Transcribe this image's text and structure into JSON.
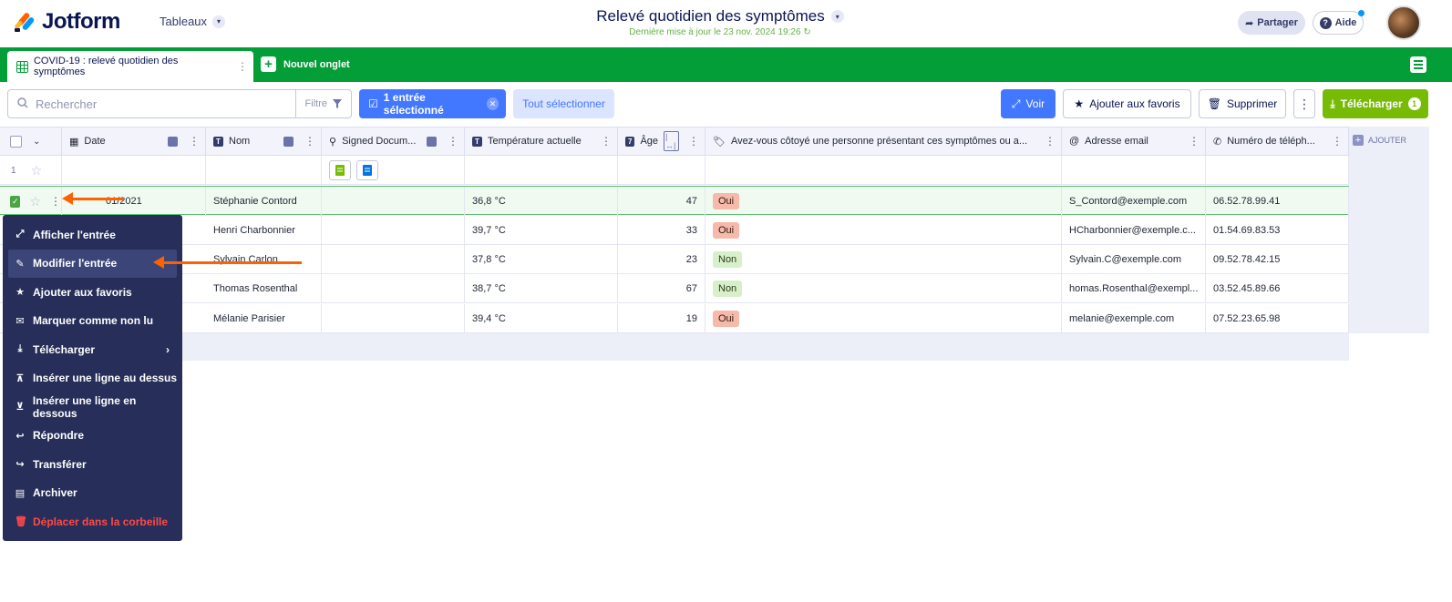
{
  "header": {
    "brand": "Jotform",
    "tables_menu": "Tableaux",
    "title": "Relevé quotidien des symptômes",
    "subtitle": "Dernière mise à jour le 23 nov. 2024 19:26",
    "share_label": "Partager",
    "help_label": "Aide"
  },
  "tabs": {
    "active_tab": "COVID-19 : relevé quotidien des symptômes",
    "new_tab": "Nouvel onglet"
  },
  "toolbar": {
    "search_placeholder": "Rechercher",
    "filter_label": "Filtre",
    "selected_label": "1 entrée sélectionné",
    "select_all_label": "Tout sélectionner",
    "view_label": "Voir",
    "favorite_label": "Ajouter aux favoris",
    "delete_label": "Supprimer",
    "download_label": "Télécharger",
    "download_count": "1"
  },
  "columns": {
    "date": "Date",
    "name": "Nom",
    "signed": "Signed Docum...",
    "temperature": "Température actuelle",
    "age": "Âge",
    "contact": "Avez-vous côtoyé une personne présentant ces symptômes ou a...",
    "email": "Adresse email",
    "phone": "Numéro de téléph...",
    "add": "AJOUTER"
  },
  "rows": [
    {
      "num": "1"
    },
    {
      "date": "01/2021",
      "name": "Stéphanie Contord",
      "temp": "36,8 °C",
      "age": "47",
      "contact": "Oui",
      "email": "S_Contord@exemple.com",
      "phone": "06.52.78.99.41"
    },
    {
      "name": "Henri Charbonnier",
      "temp": "39,7 °C",
      "age": "33",
      "contact": "Oui",
      "email": "HCharbonnier@exemple.c...",
      "phone": "01.54.69.83.53"
    },
    {
      "name": "Sylvain Carlon",
      "temp": "37,8 °C",
      "age": "23",
      "contact": "Non",
      "email": "Sylvain.C@exemple.com",
      "phone": "09.52.78.42.15"
    },
    {
      "name": "Thomas Rosenthal",
      "temp": "38,7 °C",
      "age": "67",
      "contact": "Non",
      "email": "homas.Rosenthal@exempl...",
      "phone": "03.52.45.89.66"
    },
    {
      "name": "Mélanie Parisier",
      "temp": "39,4 °C",
      "age": "19",
      "contact": "Oui",
      "email": "melanie@exemple.com",
      "phone": "07.52.23.65.98"
    }
  ],
  "context_menu": [
    {
      "label": "Afficher l'entrée",
      "icon": "expand-icon"
    },
    {
      "label": "Modifier l'entrée",
      "icon": "edit-icon"
    },
    {
      "label": "Ajouter aux favoris",
      "icon": "star-icon"
    },
    {
      "label": "Marquer comme non lu",
      "icon": "mail-icon"
    },
    {
      "label": "Télécharger",
      "icon": "download-icon"
    },
    {
      "label": "Insérer une ligne au dessus",
      "icon": "insert-above-icon"
    },
    {
      "label": "Insérer une ligne en dessous",
      "icon": "insert-below-icon"
    },
    {
      "label": "Répondre",
      "icon": "reply-icon"
    },
    {
      "label": "Transférer",
      "icon": "forward-icon"
    },
    {
      "label": "Archiver",
      "icon": "archive-icon"
    },
    {
      "label": "Déplacer dans la corbeille",
      "icon": "trash-icon"
    }
  ],
  "colors": {
    "brand_green": "#049e38",
    "primary_blue": "#4277ff",
    "download_green": "#78bb07",
    "menu_bg": "#262e59",
    "annotation": "#ff6100",
    "danger": "#ff4948"
  }
}
